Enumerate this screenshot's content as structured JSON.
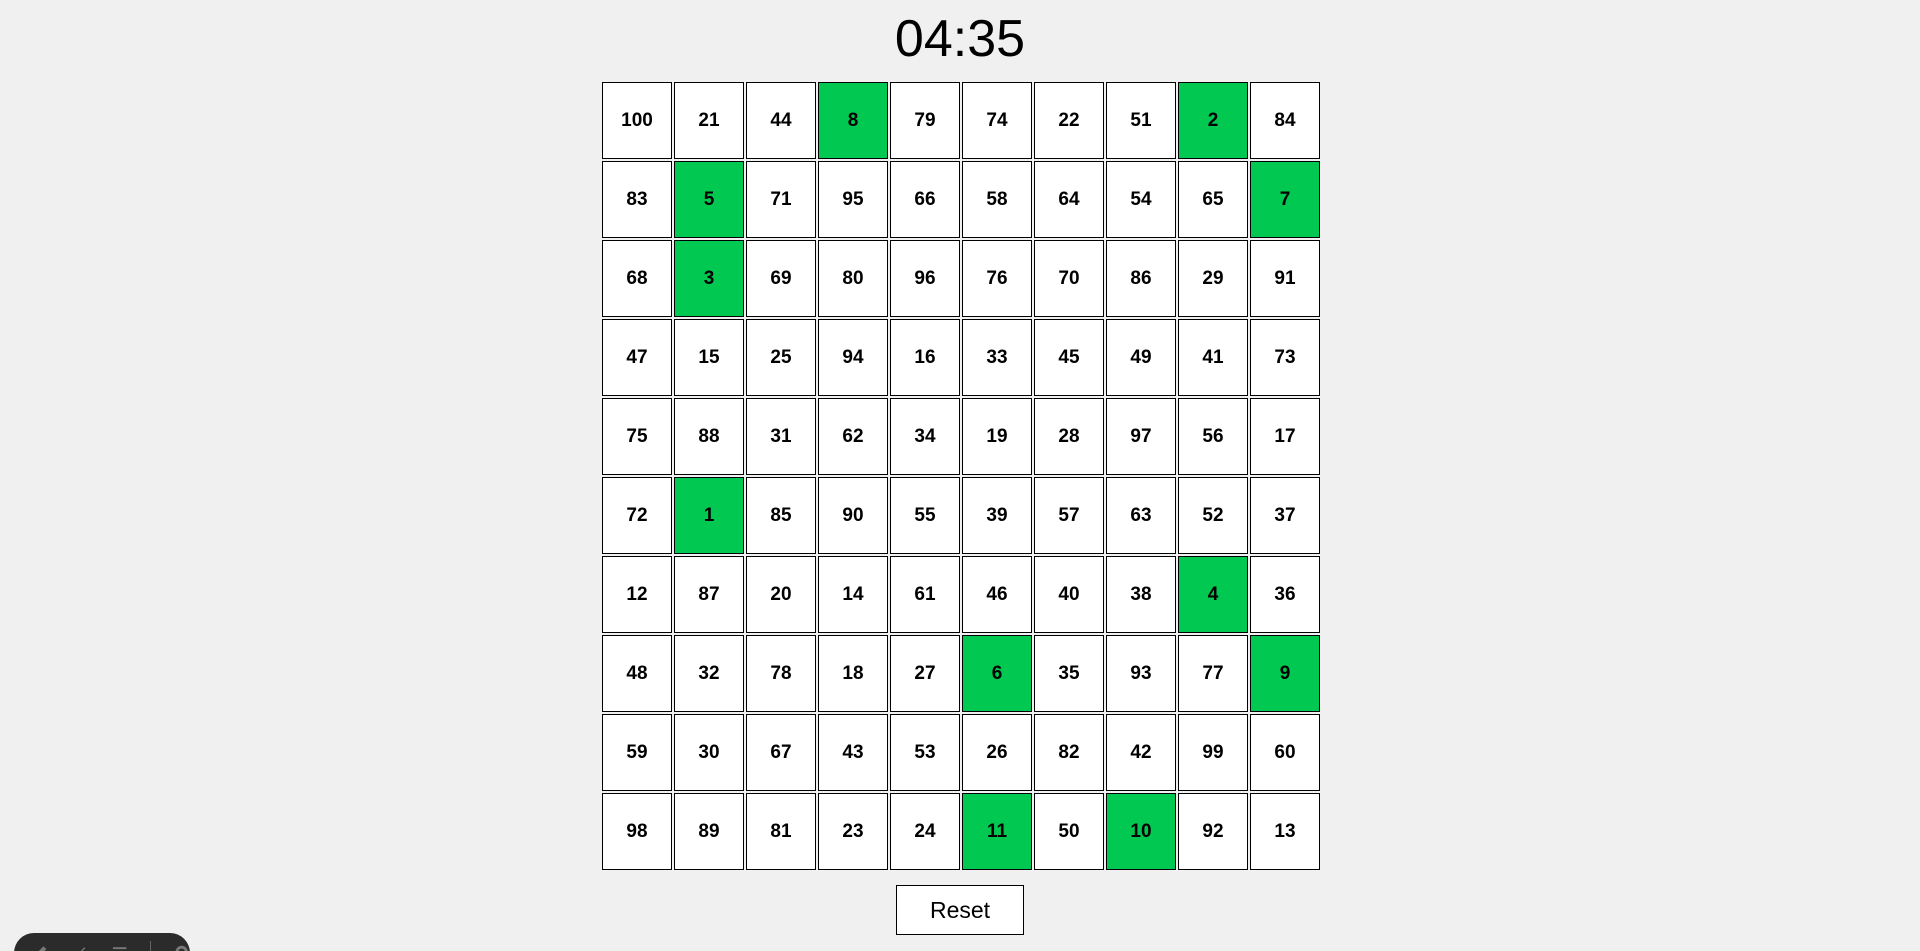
{
  "timer": {
    "display": "04:35"
  },
  "grid": {
    "rows": [
      [
        100,
        21,
        44,
        8,
        79,
        74,
        22,
        51,
        2,
        84
      ],
      [
        83,
        5,
        71,
        95,
        66,
        58,
        64,
        54,
        65,
        7
      ],
      [
        68,
        3,
        69,
        80,
        96,
        76,
        70,
        86,
        29,
        91
      ],
      [
        47,
        15,
        25,
        94,
        16,
        33,
        45,
        49,
        41,
        73
      ],
      [
        75,
        88,
        31,
        62,
        34,
        19,
        28,
        97,
        56,
        17
      ],
      [
        72,
        1,
        85,
        90,
        55,
        39,
        57,
        63,
        52,
        37
      ],
      [
        12,
        87,
        20,
        14,
        61,
        46,
        40,
        38,
        4,
        36
      ],
      [
        48,
        32,
        78,
        18,
        27,
        6,
        35,
        93,
        77,
        9
      ],
      [
        59,
        30,
        67,
        43,
        53,
        26,
        82,
        42,
        99,
        60
      ],
      [
        98,
        89,
        81,
        23,
        24,
        11,
        50,
        10,
        92,
        13
      ]
    ],
    "found_numbers": [
      1,
      2,
      3,
      4,
      5,
      6,
      7,
      8,
      9,
      10,
      11
    ]
  },
  "colors": {
    "found_cell": "#00c850",
    "default_cell": "#ffffff",
    "background": "#f0f0f0"
  },
  "controls": {
    "reset_label": "Reset"
  },
  "toolbar": {
    "icons": [
      "pen-icon",
      "brush-icon",
      "menu-icon",
      "settings-icon"
    ]
  }
}
